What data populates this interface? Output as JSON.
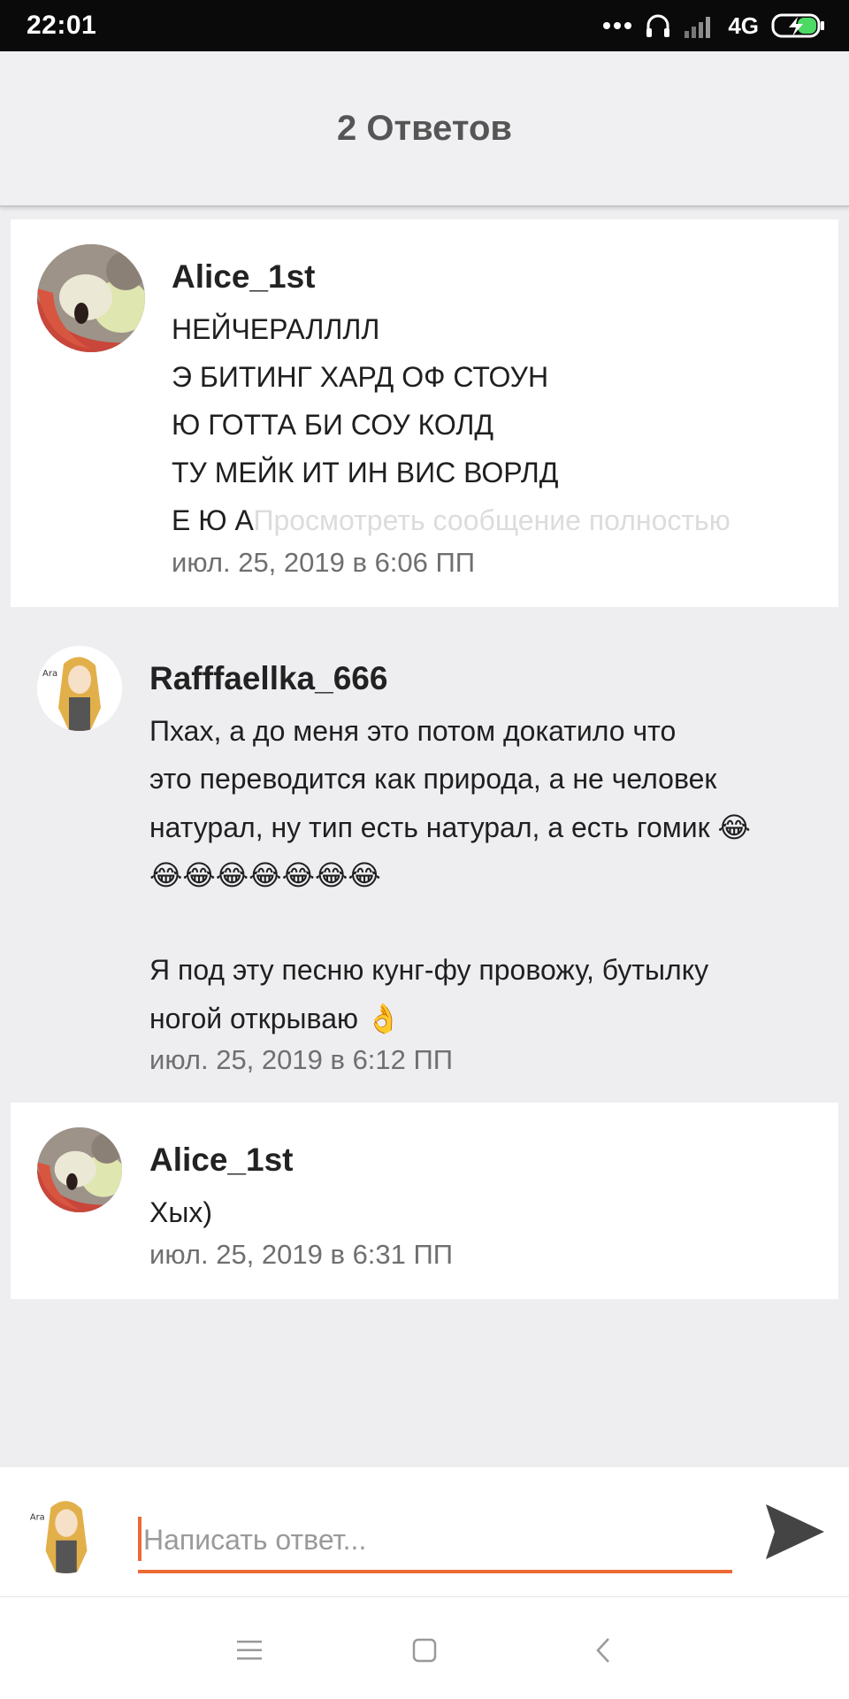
{
  "status_bar": {
    "time": "22:01",
    "network": "4G",
    "icons": [
      "more-dots-icon",
      "headset-icon",
      "signal-icon",
      "battery-charging-icon"
    ]
  },
  "header": {
    "title": "2 Ответов"
  },
  "comments": [
    {
      "username": "Alice_1st",
      "avatar": "food-avatar",
      "lines": [
        "НЕЙЧЕРАЛЛЛЛ",
        "Э БИТИНГ ХАРД ОФ СТОУН",
        "Ю ГОТТА БИ СОУ КОЛД",
        "ТУ МЕЙК ИТ ИН ВИС ВОРЛД",
        "Е Ю А"
      ],
      "more_link": "Просмотреть сообщение полностью",
      "timestamp": "июл. 25, 2019 в 6:06 ПП"
    },
    {
      "username": "Rafffaellka_666",
      "avatar": "anime-girl-avatar",
      "lines": [
        "Пхах, а до меня это потом докатило что",
        "это переводится как природа, а не человек",
        "натурал, ну тип есть натурал, а есть гомик 😂",
        "😂😂😂😂😂😂😂",
        "",
        "Я под эту песню кунг-фу провожу, бутылку",
        "ногой открываю 👌"
      ],
      "timestamp": "июл. 25, 2019 в 6:12 ПП"
    },
    {
      "username": "Alice_1st",
      "avatar": "food-avatar",
      "lines": [
        "Хых)"
      ],
      "timestamp": "июл. 25, 2019 в 6:31 ПП"
    }
  ],
  "reply": {
    "placeholder": "Написать ответ...",
    "avatar": "anime-girl-avatar"
  },
  "nav": {
    "buttons": [
      "menu-icon",
      "home-icon",
      "back-icon"
    ]
  },
  "colors": {
    "accent": "#ec6a33",
    "send": "#444444"
  }
}
